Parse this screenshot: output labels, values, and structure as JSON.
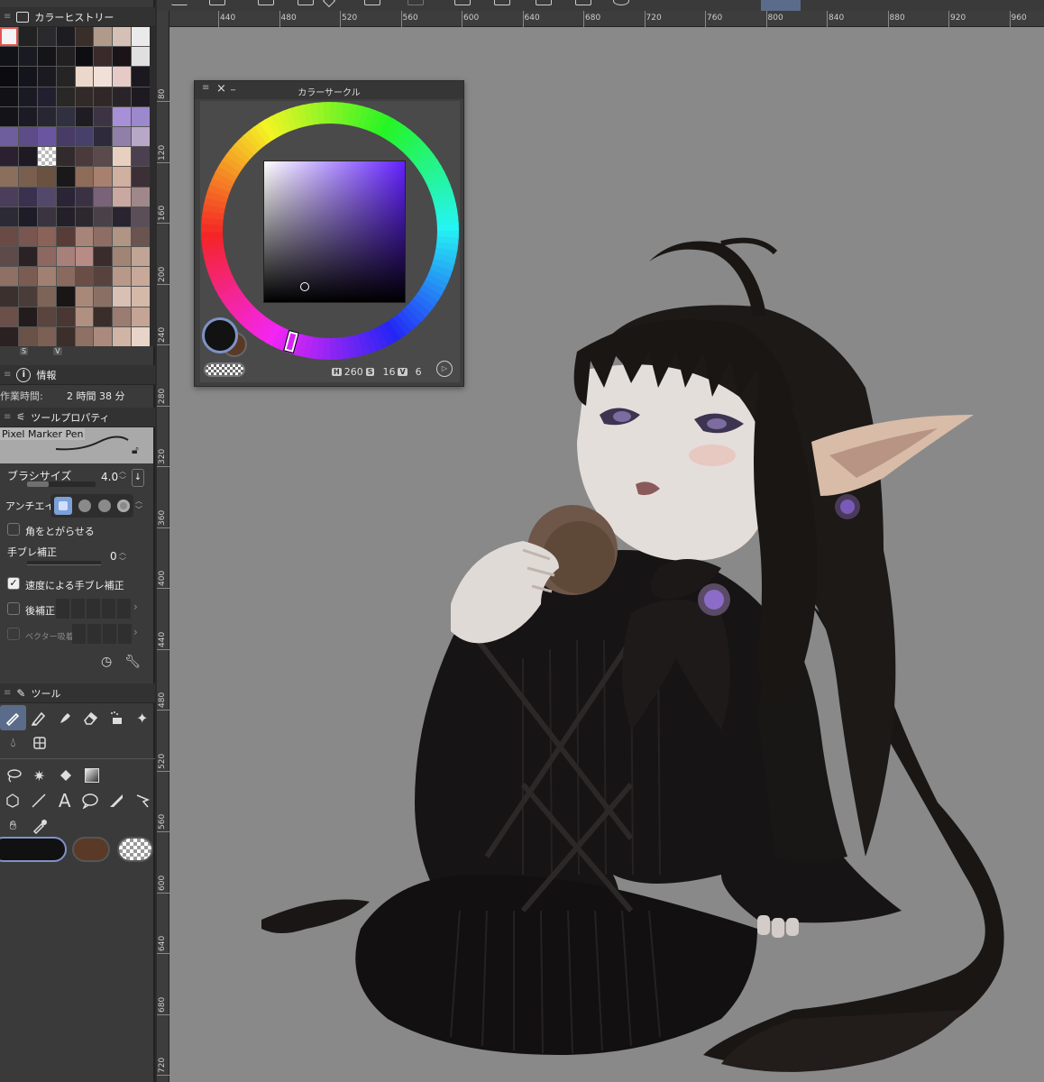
{
  "color_history": {
    "title": "カラーヒストリー",
    "swatches": [
      "#f4f4f4",
      "#222222",
      "#2a2a2e",
      "#1c1c22",
      "#3a2e2a",
      "#b09a8a",
      "#d4c0b4",
      "#eaeaea",
      "#111118",
      "#1a1a22",
      "#151518",
      "#222020",
      "#0e0e12",
      "#3a2a2a",
      "#1a1418",
      "#e0e0e0",
      "#0c0c10",
      "#14141c",
      "#1a1a20",
      "#262424",
      "#ecd8ca",
      "#f0e0d8",
      "#e6cac6",
      "#1c1820",
      "#121216",
      "#1a1a24",
      "#222030",
      "#2a2826",
      "#322a28",
      "#302828",
      "#2a2428",
      "#1e1a22",
      "#141418",
      "#1c1a24",
      "#282632",
      "#303040",
      "#201c24",
      "#3c3444",
      "#a890d8",
      "#9c88cc",
      "#6e5e9c",
      "#5c4c88",
      "#6a56a0",
      "#483c66",
      "#46406a",
      "#2e2a3a",
      "#9080a8",
      "#b8a8c8",
      "#2a2030",
      "#1e1a24",
      "checker",
      "#322a2c",
      "#4a3a3c",
      "#5a4a4c",
      "#e8d0c0",
      "#4a4050",
      "#8c6e5c",
      "#7a5e4e",
      "#6a5240",
      "#1a1818",
      "#8e6c58",
      "#a88070",
      "#d0b0a0",
      "#3c3036",
      "#4a3e5c",
      "#3a3050",
      "#54486a",
      "#2a2436",
      "#3a3244",
      "#7a6278",
      "#c8a8a0",
      "#a0888a",
      "#2c2a34",
      "#1e1c26",
      "#3a3440",
      "#24202a",
      "#2c282e",
      "#4a4048",
      "#2a2430",
      "#5a4e58",
      "#6a4a44",
      "#7a5650",
      "#8a6258",
      "#583c38",
      "#a88478",
      "#8e6e64",
      "#b09484",
      "#6a5450",
      "#5e4a48",
      "#2a2224",
      "#8c6860",
      "#a8807a",
      "#b88c84",
      "#3a2c2c",
      "#a08474",
      "#c0a494",
      "#8e7064",
      "#7a5c52",
      "#a08070",
      "#8a6a5e",
      "#6a4e46",
      "#58423e",
      "#b89888",
      "#c8a898",
      "#3c302e",
      "#4a3c38",
      "#7e6458",
      "#1a1616",
      "#a88878",
      "#8a7064",
      "#d8c0b4",
      "#d4b8a8",
      "#6a5048",
      "#221c1c",
      "#5a443e",
      "#4a3632",
      "#b09080",
      "#3a2e2a",
      "#9a7c70",
      "#c4a494",
      "#2a2222",
      "#6a5248",
      "#7c6054",
      "#3c2e2a",
      "#8e7064",
      "#aa8a7c",
      "#d0b4a4",
      "#e8d4c8"
    ],
    "hsv_tags": [
      "S",
      "V"
    ]
  },
  "info": {
    "title": "情報",
    "label": "作業時間:",
    "value": "2 時間 38 分"
  },
  "tool_property": {
    "title": "ツールプロパティ",
    "brush_name": "Pixel Marker Pen",
    "brush_size_label": "ブラシサイズ",
    "brush_size": "4.0",
    "antialias_label": "アンチエイリアス",
    "sharpen_label": "角をとがらせる",
    "stabilization_label": "手ブレ補正",
    "stabilization_value": "0",
    "speed_stab_label": "速度による手ブレ補正",
    "post_correction_label": "後補正",
    "vector_snap_label": "ベクター吸着"
  },
  "tools": {
    "title": "ツール"
  },
  "ruler": {
    "top_labels": [
      "440",
      "480",
      "520",
      "560",
      "600",
      "640",
      "680",
      "720",
      "760",
      "800",
      "840",
      "880",
      "920",
      "960"
    ],
    "left_labels": [
      "80",
      "120",
      "160",
      "200",
      "240",
      "280",
      "320",
      "360",
      "400",
      "440",
      "480",
      "520",
      "560",
      "600",
      "640",
      "680",
      "720"
    ]
  },
  "color_circle": {
    "title": "カラーサークル",
    "h_label": "H",
    "h_value": "260",
    "s_label": "S",
    "s_value": "16",
    "v_label": "V",
    "v_value": "6",
    "hue": 260,
    "saturation": 16,
    "value": 6
  },
  "colors": {
    "main_color": "#121212",
    "sub_color": "#5a3a26",
    "accent": "#5b6c8a",
    "canvas_bg": "#898989"
  }
}
